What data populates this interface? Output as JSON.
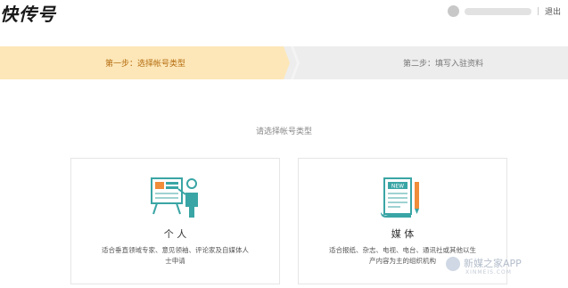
{
  "header": {
    "logo_text": "快传号",
    "logout_label": "退出",
    "separator": "|"
  },
  "steps": {
    "step1_label": "第一步：选择帐号类型",
    "step2_label": "第二步：填写入驻资料"
  },
  "main": {
    "prompt": "请选择帐号类型",
    "cards": [
      {
        "title": "个 人",
        "description": "适合垂直领域专家、意见领袖、评论家及自媒体人士申请",
        "icon": "presenter-board-icon"
      },
      {
        "title": "媒 体",
        "description": "适合报纸、杂志、电视、电台、通讯社或其他以生产内容为主的组织机构",
        "icon": "newspaper-icon"
      }
    ]
  },
  "watermark": {
    "text": "新媒之家APP",
    "sub": "XINMEIS.COM"
  },
  "colors": {
    "active_step_bg": "#fde7b8",
    "active_step_text": "#b56d10",
    "inactive_step_bg": "#ededed",
    "icon_teal": "#3aa5a5",
    "icon_orange": "#f08c3a"
  }
}
